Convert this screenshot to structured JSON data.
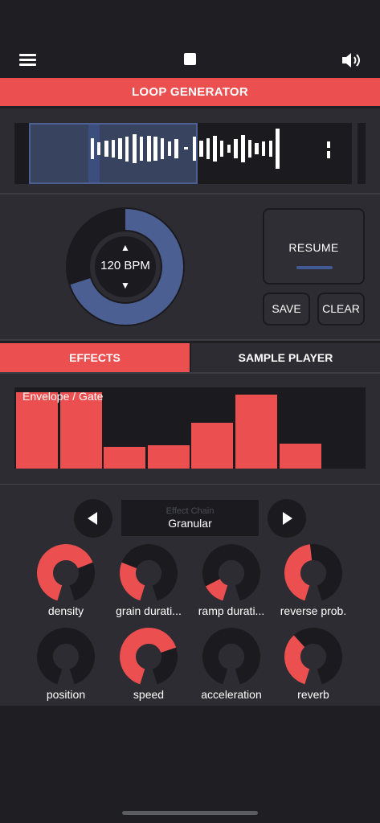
{
  "header": {
    "menu_icon": "hamburger-menu-icon",
    "stop_icon": "stop-square-icon",
    "volume_icon": "speaker-volume-icon",
    "title": "LOOP GENERATOR"
  },
  "tempo": {
    "label": "120 BPM",
    "up_glyph": "▲",
    "down_glyph": "▼"
  },
  "transport": {
    "resume": "RESUME",
    "save": "SAVE",
    "clear": "CLEAR"
  },
  "tabs": [
    {
      "label": "EFFECTS",
      "active": true
    },
    {
      "label": "SAMPLE PLAYER",
      "active": false
    }
  ],
  "envelope": {
    "label": "Envelope / Gate",
    "levels": [
      1.0,
      1.0,
      0.28,
      0.31,
      0.6,
      0.97,
      0.33,
      0
    ]
  },
  "effect_chain": {
    "title": "Effect Chain",
    "value": "Granular"
  },
  "knobs": [
    {
      "label": "density",
      "fraction": 0.71
    },
    {
      "label": "grain durati...",
      "fraction": 0.29
    },
    {
      "label": "ramp durati...",
      "fraction": 0.14
    },
    {
      "label": "reverse prob.",
      "fraction": 0.48
    },
    {
      "label": "position",
      "fraction": 0.0
    },
    {
      "label": "speed",
      "fraction": 0.72
    },
    {
      "label": "acceleration",
      "fraction": 0.0
    },
    {
      "label": "reverb",
      "fraction": 0.37
    }
  ],
  "colors": {
    "accent": "#ec4f4f",
    "selection": "#4b5f92",
    "panel": "#2c2c32",
    "track": "#1b1b1f"
  }
}
